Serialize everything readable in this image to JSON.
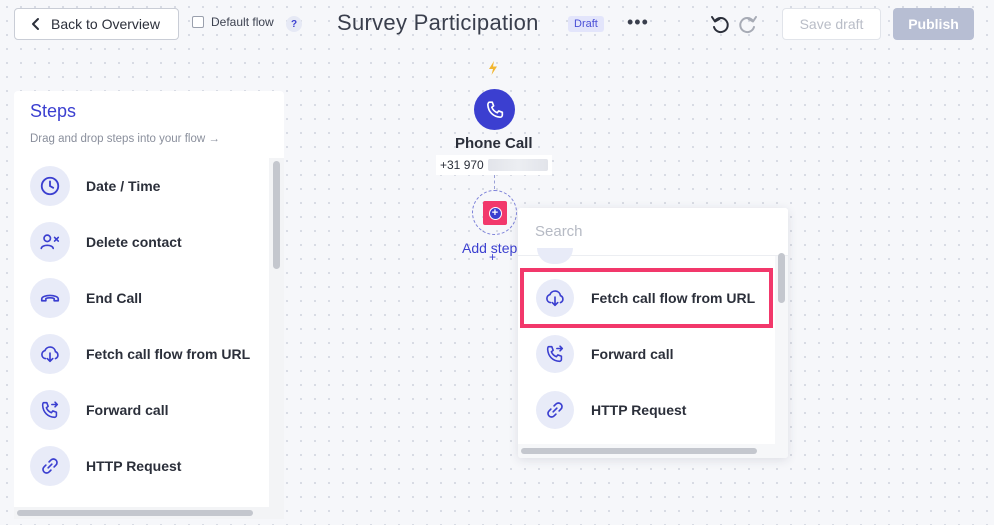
{
  "header": {
    "back_label": "Back to Overview",
    "default_flow_label": "Default flow",
    "help_label": "?",
    "title": "Survey Participation",
    "status_badge": "Draft",
    "more_label": "•••",
    "save_draft_label": "Save draft",
    "publish_label": "Publish"
  },
  "steps_panel": {
    "title": "Steps",
    "subtitle": "Drag and drop steps into your flow →",
    "items": [
      {
        "label": "Date / Time",
        "icon": "clock-icon"
      },
      {
        "label": "Delete contact",
        "icon": "remove-user-icon"
      },
      {
        "label": "End Call",
        "icon": "hang-up-icon"
      },
      {
        "label": "Fetch call flow from URL",
        "icon": "cloud-download-icon"
      },
      {
        "label": "Forward call",
        "icon": "forward-call-icon"
      },
      {
        "label": "HTTP Request",
        "icon": "link-icon"
      }
    ]
  },
  "canvas": {
    "trigger_title": "Phone Call",
    "trigger_number": "+31 970",
    "add_step_label": "Add step",
    "add_step_plus": "+"
  },
  "dropdown": {
    "search_placeholder": "Search",
    "items": [
      {
        "label": "Fetch call flow from URL",
        "icon": "cloud-download-icon",
        "highlighted": true
      },
      {
        "label": "Forward call",
        "icon": "forward-call-icon",
        "highlighted": false
      },
      {
        "label": "HTTP Request",
        "icon": "link-icon",
        "highlighted": false
      }
    ]
  },
  "colors": {
    "accent": "#3b3fd0",
    "highlight": "#f2386b",
    "icon_bg": "#e8ebf8",
    "publish_disabled": "#b7bed3"
  }
}
